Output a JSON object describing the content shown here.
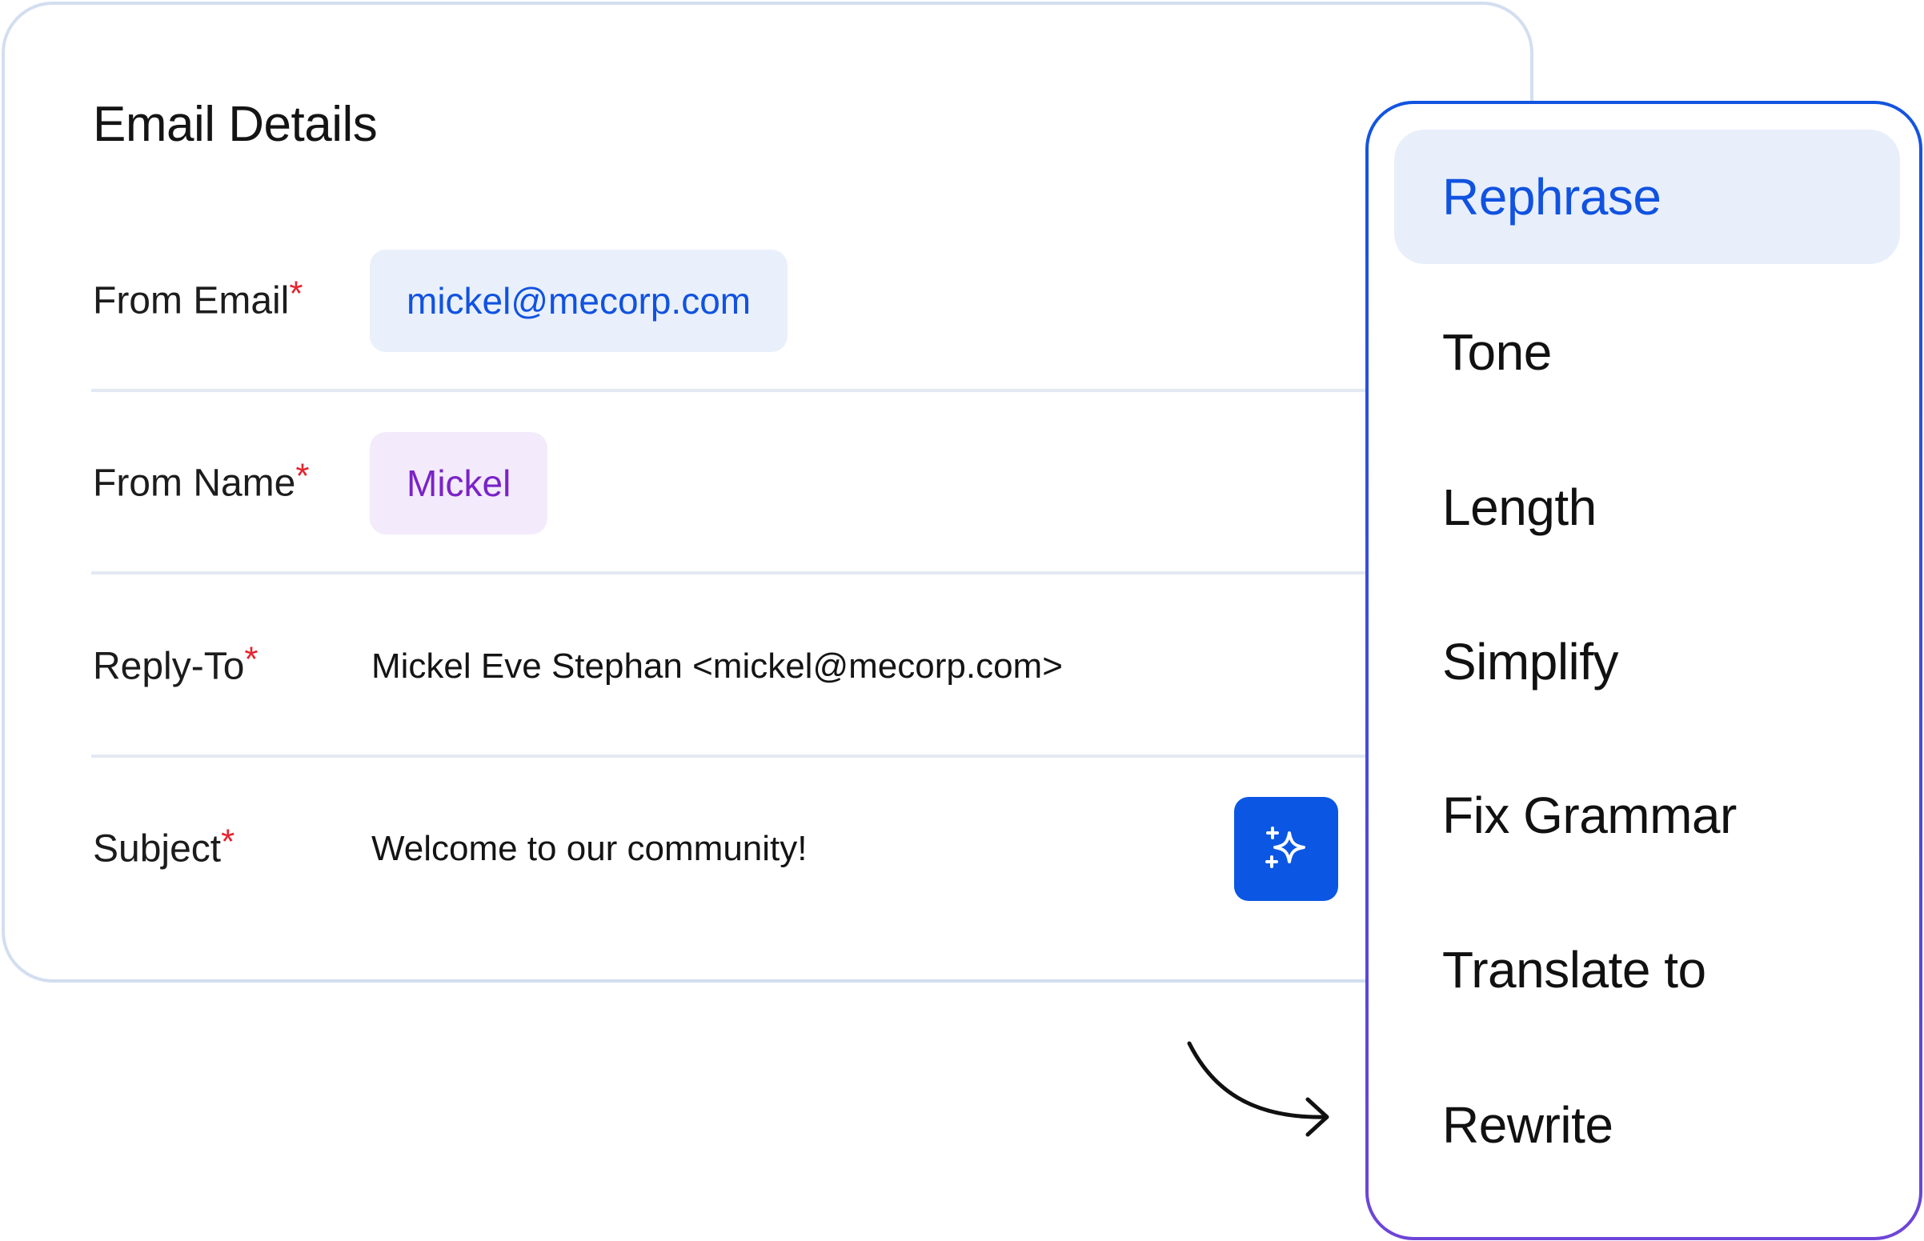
{
  "colors": {
    "accent": "#0b57e3",
    "email_chip_bg": "#e9f0fb",
    "email_chip_text": "#1152e0",
    "name_chip_bg": "#f3ebfb",
    "name_chip_text": "#7a23c8",
    "required_marker": "#e6232e",
    "menu_active_bg": "#e8effb"
  },
  "card": {
    "title": "Email Details",
    "required_marker": "*",
    "fields": {
      "from_email": {
        "label": "From Email",
        "value": "mickel@mecorp.com"
      },
      "from_name": {
        "label": "From Name",
        "value": "Mickel"
      },
      "reply_to": {
        "label": "Reply-To",
        "value": "Mickel Eve Stephan <mickel@mecorp.com>"
      },
      "subject": {
        "label": "Subject",
        "value": "Welcome to our community!"
      }
    },
    "ai_button_icon": "sparkles-icon"
  },
  "arrow_icon": "curved-arrow-icon",
  "ai_menu": {
    "items": [
      {
        "label": "Rephrase",
        "active": true
      },
      {
        "label": "Tone",
        "active": false
      },
      {
        "label": "Length",
        "active": false
      },
      {
        "label": "Simplify",
        "active": false
      },
      {
        "label": "Fix Grammar",
        "active": false
      },
      {
        "label": "Translate to",
        "active": false
      },
      {
        "label": "Rewrite",
        "active": false
      }
    ]
  }
}
